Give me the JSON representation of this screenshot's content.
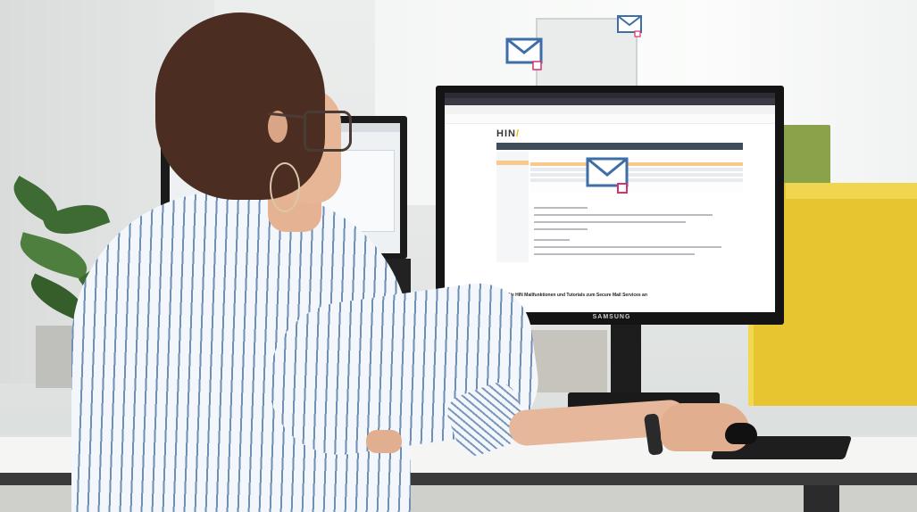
{
  "scene": {
    "description_alt": "",
    "monitor_brand": "SAMSUNG",
    "screen": {
      "logo": "HIN",
      "footer_heading": "Die HIN Mailfunktionen und Tutorials zum Secure Mail Services an"
    },
    "icons": [
      "mail-icon",
      "mail-lock-icon"
    ],
    "colors": {
      "mail_icon_blue": "#3d6ea8",
      "lock_pink": "#d6336c",
      "selected_row": "#f7c98d",
      "cabinet_yellow": "#e6c530"
    }
  }
}
